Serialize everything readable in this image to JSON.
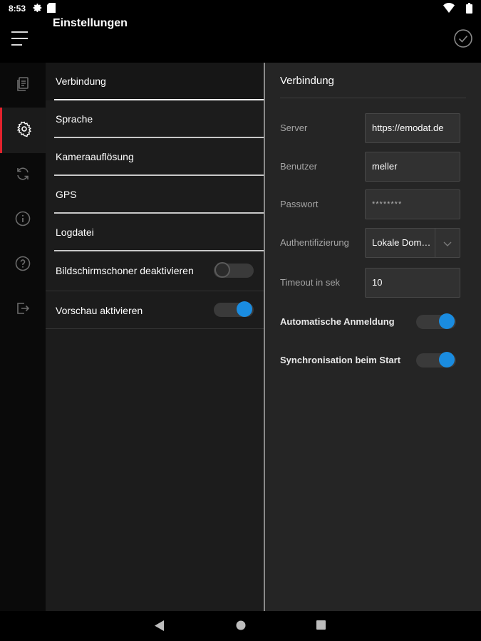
{
  "status_bar": {
    "time": "8:53",
    "icons": [
      "gear-icon",
      "sd-card-icon",
      "wifi-icon",
      "battery-icon"
    ]
  },
  "app_bar": {
    "title": "Einstellungen",
    "menu_icon": "hamburger-menu-icon",
    "confirm_icon": "check-circle-icon"
  },
  "rail": {
    "items": [
      {
        "icon": "documents-icon",
        "active": false
      },
      {
        "icon": "settings-gear-icon",
        "active": true
      },
      {
        "icon": "sync-icon",
        "active": false
      },
      {
        "icon": "info-icon",
        "active": false
      },
      {
        "icon": "help-icon",
        "active": false
      },
      {
        "icon": "logout-icon",
        "active": false
      }
    ],
    "accent_color": "#e3222d"
  },
  "menu": {
    "items": [
      {
        "label": "Verbindung",
        "active": true
      },
      {
        "label": "Sprache"
      },
      {
        "label": "Kameraauflösung"
      },
      {
        "label": "GPS"
      },
      {
        "label": "Logdatei"
      }
    ],
    "switches": [
      {
        "label": "Bildschirmschoner deaktivieren",
        "on": false
      },
      {
        "label": "Vorschau aktivieren",
        "on": true
      }
    ]
  },
  "detail": {
    "heading": "Verbindung",
    "fields": {
      "server": {
        "label": "Server",
        "value": "https://emodat.de"
      },
      "user": {
        "label": "Benutzer",
        "value": "meller"
      },
      "password": {
        "label": "Passwort",
        "value": "********"
      },
      "auth": {
        "label": "Authentifizierung",
        "value": "Lokale Domäne"
      },
      "timeout": {
        "label": "Timeout in sek",
        "value": "10"
      }
    },
    "switches": [
      {
        "label": "Automatische Anmeldung",
        "on": true
      },
      {
        "label": "Synchronisation beim Start",
        "on": true
      }
    ]
  },
  "nav_bar": {
    "icons": [
      "back-icon",
      "home-icon",
      "recents-icon"
    ]
  },
  "colors": {
    "toggle_on": "#1a8ce0",
    "background": "#000000",
    "panel": "#252525"
  }
}
